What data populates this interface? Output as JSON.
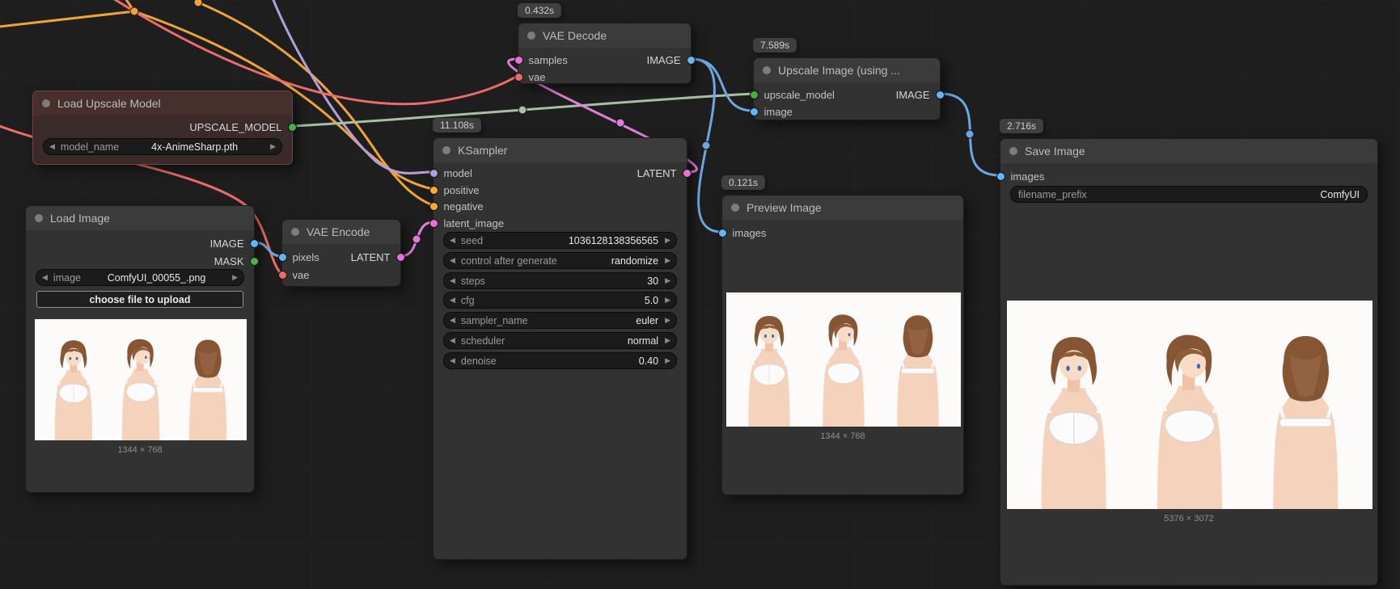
{
  "icons": {
    "arrow_left": "◀",
    "arrow_right": "▶"
  },
  "colors": {
    "port_image": "#64b5f6",
    "port_mask": "#4caf50",
    "port_upscale_model": "#44b044",
    "port_latent": "#ee6ed8",
    "port_vae": "#f06a6a",
    "port_model": "#b39ddb",
    "port_conditioning": "#ffa931",
    "wire_green": "#a9bfa4",
    "node_bg": "#323232",
    "canvas_bg": "#1e1e1e"
  },
  "nodes": {
    "vae_decode": {
      "badge": "0.432s",
      "title": "VAE Decode",
      "inputs": [
        "samples",
        "vae"
      ],
      "outputs": [
        "IMAGE"
      ]
    },
    "load_upscale_model": {
      "title": "Load Upscale Model",
      "outputs": [
        "UPSCALE_MODEL"
      ],
      "widgets": [
        {
          "label": "model_name",
          "value": "4x-AnimeSharp.pth"
        }
      ]
    },
    "upscale_image": {
      "badge": "7.589s",
      "title": "Upscale Image (using ...",
      "inputs": [
        "upscale_model",
        "image"
      ],
      "outputs": [
        "IMAGE"
      ]
    },
    "load_image": {
      "title": "Load Image",
      "outputs": [
        "IMAGE",
        "MASK"
      ],
      "widgets": [
        {
          "label": "image",
          "value": "ComfyUI_00055_.png"
        }
      ],
      "button": "choose file to upload",
      "caption": "1344 × 768"
    },
    "vae_encode": {
      "title": "VAE Encode",
      "inputs": [
        "pixels",
        "vae"
      ],
      "outputs": [
        "LATENT"
      ]
    },
    "ksampler": {
      "badge": "11.108s",
      "title": "KSampler",
      "inputs": [
        "model",
        "positive",
        "negative",
        "latent_image"
      ],
      "outputs": [
        "LATENT"
      ],
      "widgets": [
        {
          "label": "seed",
          "value": "1036128138356565"
        },
        {
          "label": "control after generate",
          "value": "randomize"
        },
        {
          "label": "steps",
          "value": "30"
        },
        {
          "label": "cfg",
          "value": "5.0"
        },
        {
          "label": "sampler_name",
          "value": "euler"
        },
        {
          "label": "scheduler",
          "value": "normal"
        },
        {
          "label": "denoise",
          "value": "0.40"
        }
      ]
    },
    "preview_image": {
      "badge": "0.121s",
      "title": "Preview Image",
      "inputs": [
        "images"
      ],
      "caption": "1344 × 768"
    },
    "save_image": {
      "badge": "2.716s",
      "title": "Save Image",
      "inputs": [
        "images"
      ],
      "widgets": [
        {
          "label": "filename_prefix",
          "value": "ComfyUI"
        }
      ],
      "caption": "5376 × 3072"
    }
  }
}
